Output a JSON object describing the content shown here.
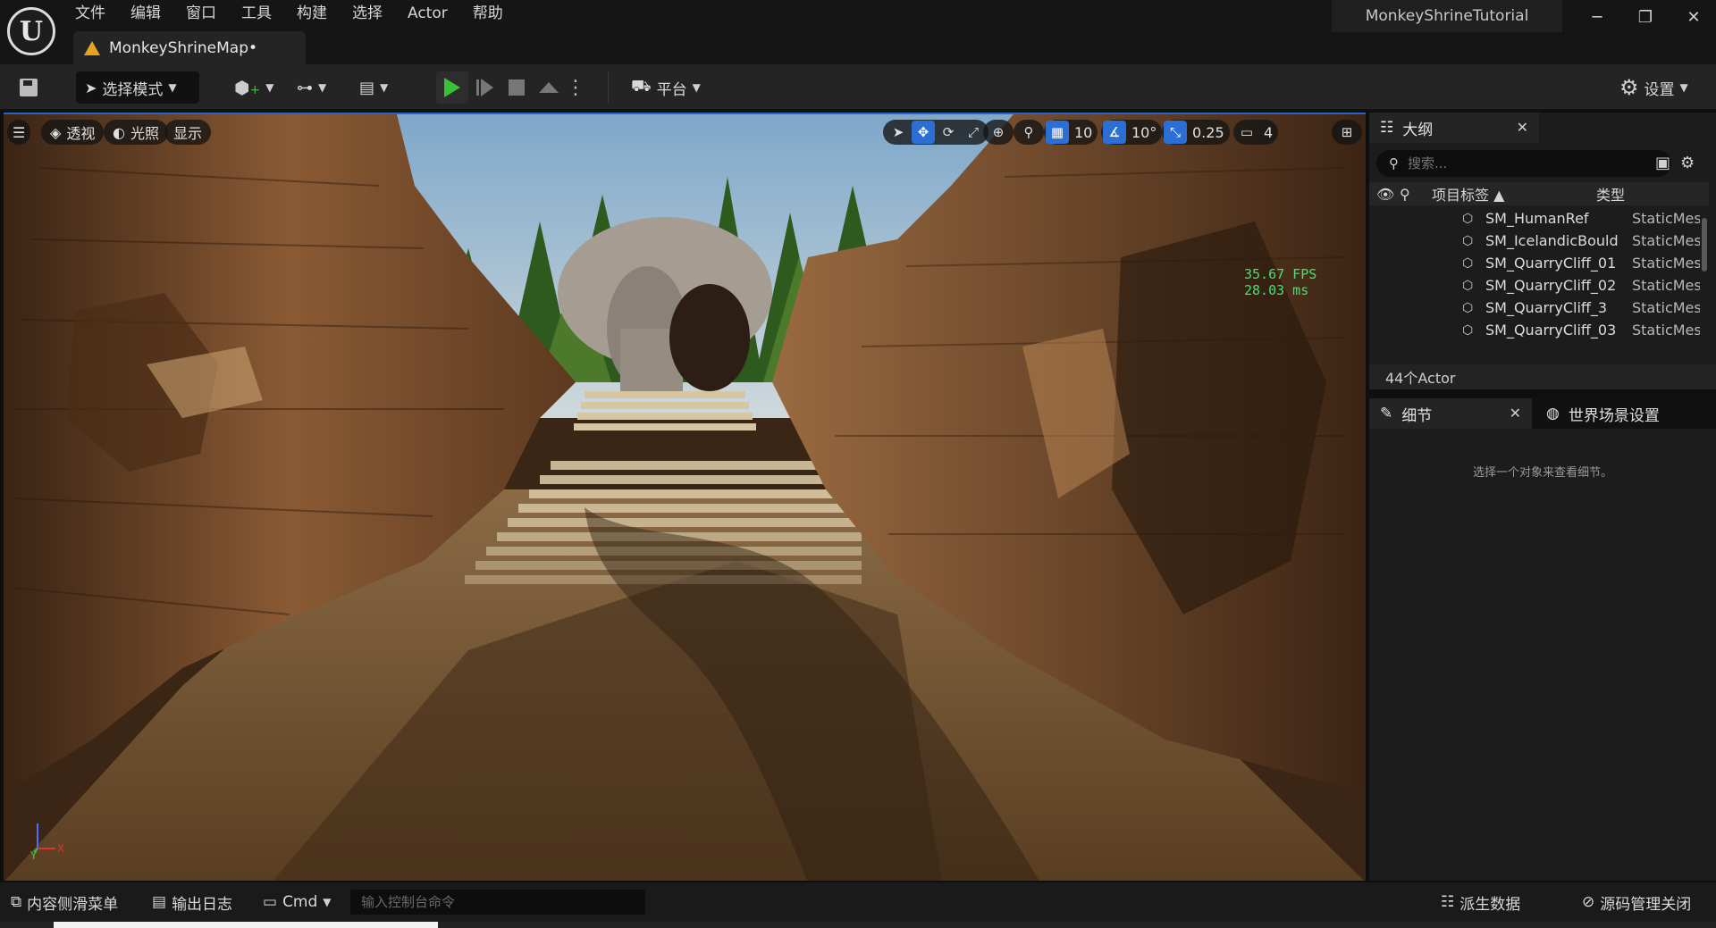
{
  "menu": [
    "文件",
    "编辑",
    "窗口",
    "工具",
    "构建",
    "选择",
    "Actor",
    "帮助"
  ],
  "document_tab": {
    "label": "MonkeyShrineMap•"
  },
  "project_name": "MonkeyShrineTutorial",
  "toolbar": {
    "mode_label": "选择模式",
    "platform_label": "平台",
    "settings_label": "设置"
  },
  "viewport": {
    "perspective_label": "透视",
    "lighting_label": "光照",
    "show_label": "显示",
    "grid_snap": "10",
    "rotation_snap": "10°",
    "scale_snap": "0.25",
    "camera_speed": "4",
    "fps": "35.67 FPS",
    "frame_time": "28.03 ms",
    "axis_y": "Y",
    "axis_x": "X"
  },
  "outliner": {
    "tab_label": "大纲",
    "search_placeholder": "搜索...",
    "col_label": "项目标签",
    "col_type": "类型",
    "rows": [
      {
        "name": "SM_HumanRef",
        "type": "StaticMes"
      },
      {
        "name": "SM_IcelandicBould",
        "type": "StaticMes"
      },
      {
        "name": "SM_QuarryCliff_01",
        "type": "StaticMes"
      },
      {
        "name": "SM_QuarryCliff_02",
        "type": "StaticMes"
      },
      {
        "name": "SM_QuarryCliff_3",
        "type": "StaticMes"
      },
      {
        "name": "SM_QuarryCliff_03",
        "type": "StaticMes"
      }
    ],
    "actor_count": "44个Actor"
  },
  "details": {
    "tab_label": "细节",
    "world_tab_label": "世界场景设置",
    "empty_message": "选择一个对象来查看细节。"
  },
  "statusbar": {
    "content_drawer": "内容侧滑菜单",
    "output_log": "输出日志",
    "cmd": "Cmd",
    "console_placeholder": "输入控制台命令",
    "derived_data": "派生数据",
    "source_control": "源码管理关闭"
  },
  "colors": {
    "accent_blue": "#2b6ed4",
    "play_green": "#39c134",
    "warning_orange": "#e8a321",
    "fps_green": "#48e070"
  }
}
